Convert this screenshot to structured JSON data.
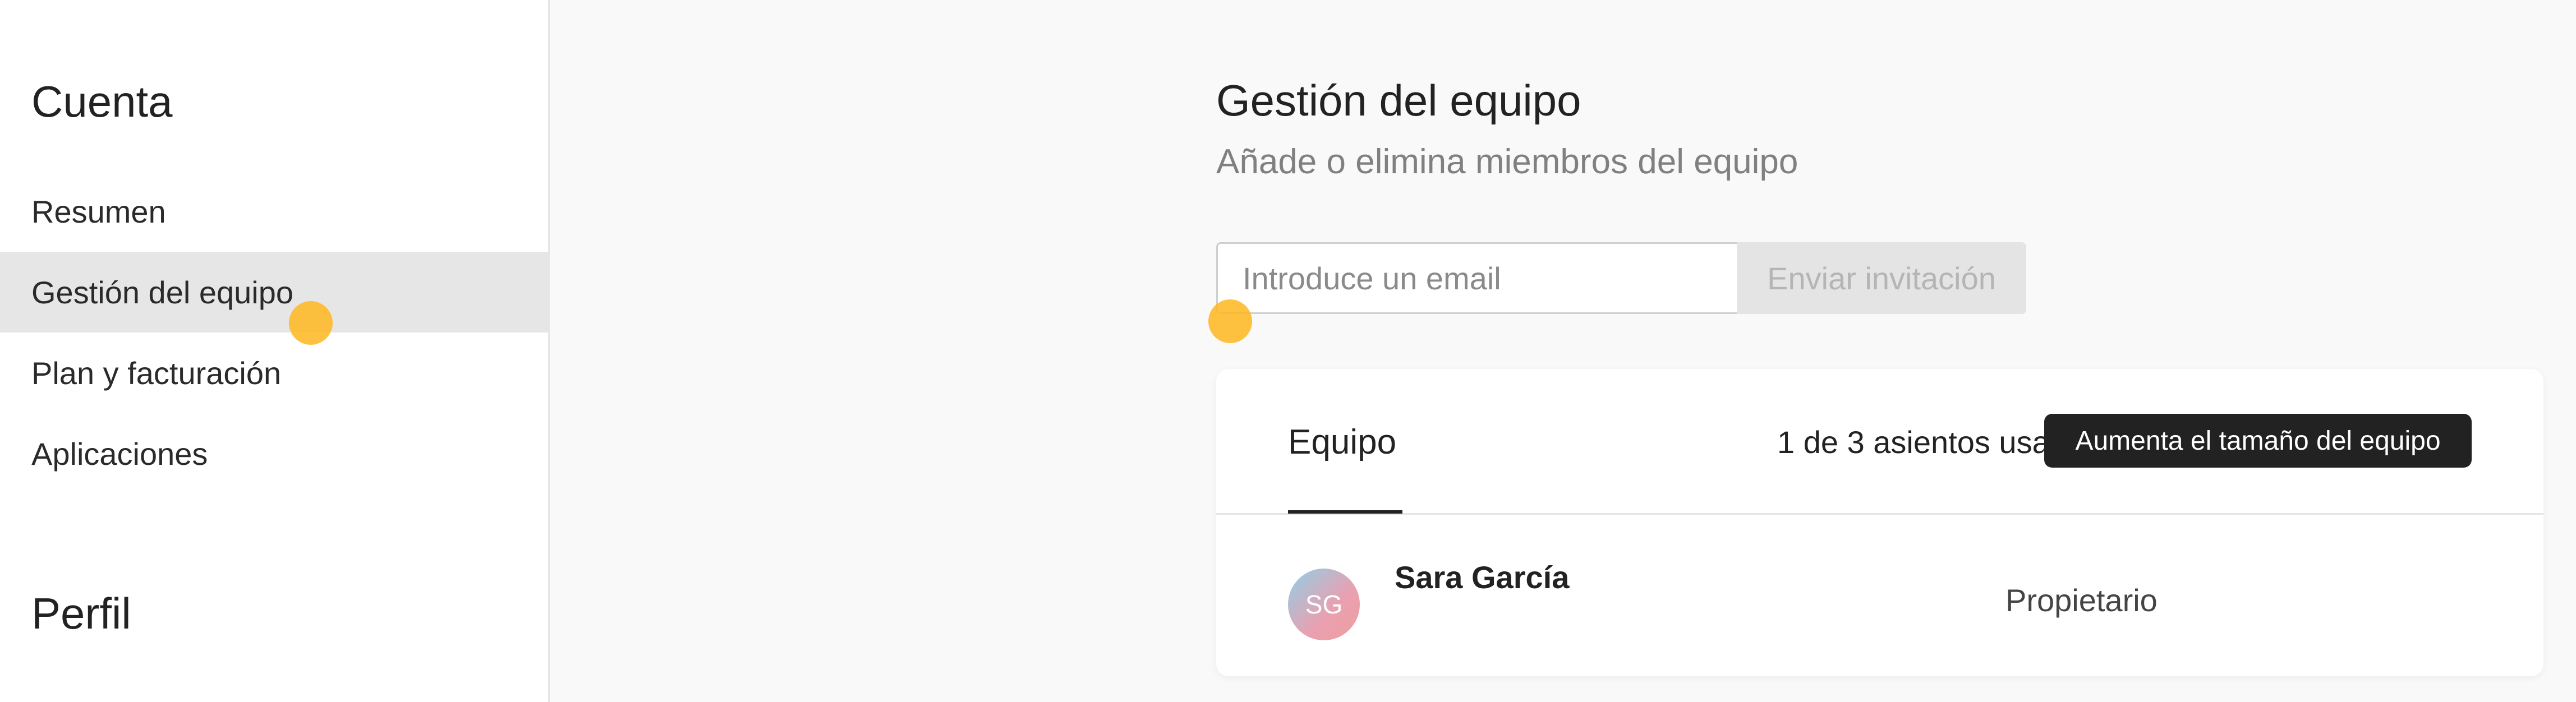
{
  "sidebar": {
    "account_heading": "Cuenta",
    "items": [
      {
        "label": "Resumen",
        "active": false
      },
      {
        "label": "Gestión del equipo",
        "active": true
      },
      {
        "label": "Plan y facturación",
        "active": false
      },
      {
        "label": "Aplicaciones",
        "active": false
      }
    ],
    "profile_heading": "Perfil"
  },
  "main": {
    "title": "Gestión del equipo",
    "subtitle": "Añade o elimina miembros del equipo",
    "invite": {
      "email_placeholder": "Introduce un email",
      "email_value": "",
      "send_label": "Enviar invitación"
    },
    "team_card": {
      "tab_label": "Equipo",
      "seats_text": "1 de 3 asientos usados",
      "upgrade_label": "Aumenta el tamaño del equipo",
      "members": [
        {
          "initials": "SG",
          "name": "Sara García",
          "role": "Propietario"
        }
      ]
    }
  },
  "colors": {
    "accent_dark": "#222222",
    "active_nav_bg": "#e6e6e6",
    "disabled_button_bg": "#e4e4e4",
    "click_marker": "#ffb71e"
  }
}
